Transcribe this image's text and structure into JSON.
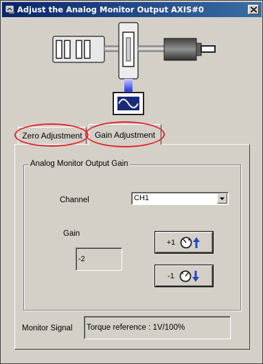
{
  "window": {
    "title": "Adjust the Analog Monitor Output AXIS#0"
  },
  "tabs": [
    {
      "label": "Zero Adjustment",
      "selected": false
    },
    {
      "label": "Gain Adjustment",
      "selected": true
    }
  ],
  "group": {
    "legend": "Analog Monitor Output Gain"
  },
  "channel": {
    "label": "Channel",
    "value": "CH1"
  },
  "gain": {
    "label": "Gain",
    "value": "-2",
    "increment_label": "+1",
    "decrement_label": "-1"
  },
  "monitor": {
    "label": "Monitor Signal",
    "value": "Torque reference : 1V/100%"
  },
  "colors": {
    "highlight_oval": "#e0242a",
    "signal_beam": "#3340e0",
    "title_bar": "#0a246a"
  }
}
